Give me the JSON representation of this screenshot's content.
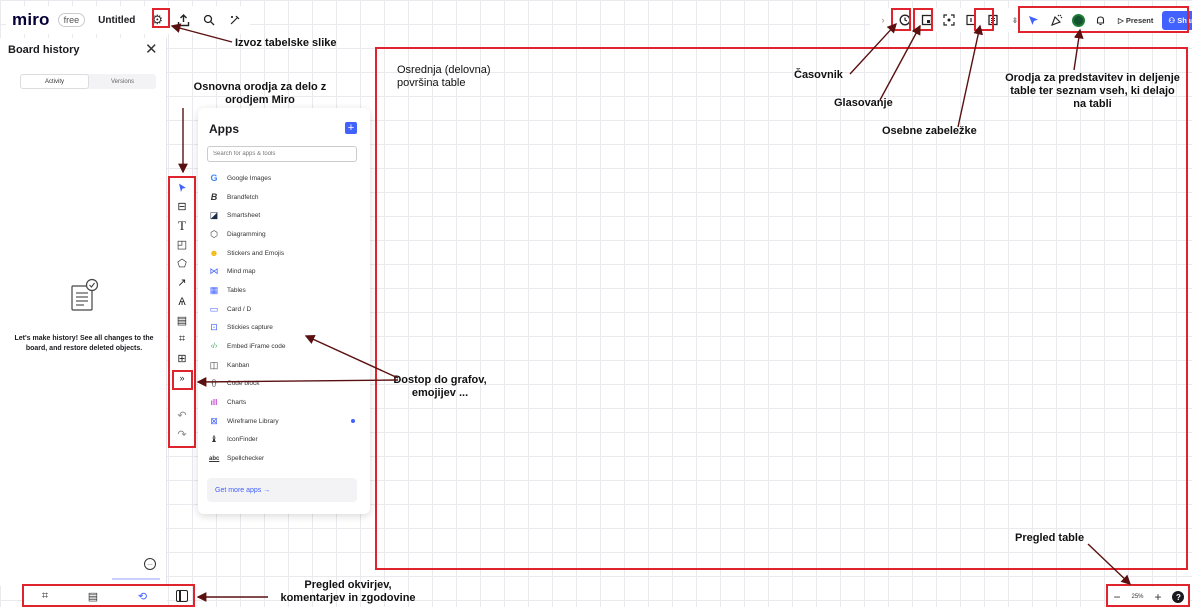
{
  "topbar": {
    "logo": "miro",
    "plan": "free",
    "board_name": "Untitled",
    "icons": [
      "gear-icon",
      "export-icon",
      "search-icon",
      "magic-icon"
    ]
  },
  "toolbar_right": {
    "present_label": "▷ Present",
    "share_label": "Share",
    "accent": "#4262ff"
  },
  "history": {
    "title": "Board history",
    "tabs": [
      "Activity",
      "Versions"
    ],
    "empty_message": "Let's make history! See all changes to the board, and restore deleted objects."
  },
  "apps": {
    "title": "Apps",
    "search_placeholder": "Search for apps & tools",
    "items": [
      {
        "label": "Google Images",
        "icon": "G"
      },
      {
        "label": "Brandfetch",
        "icon": "B"
      },
      {
        "label": "Smartsheet",
        "icon": "◪"
      },
      {
        "label": "Diagramming",
        "icon": "⬡"
      },
      {
        "label": "Stickers and Emojis",
        "icon": "☻"
      },
      {
        "label": "Mind map",
        "icon": "⋈"
      },
      {
        "label": "Tables",
        "icon": "▦"
      },
      {
        "label": "Card / D",
        "icon": "▭"
      },
      {
        "label": "Stickies capture",
        "icon": "⊡"
      },
      {
        "label": "Embed iFrame code",
        "icon": "‹/›"
      },
      {
        "label": "Kanban",
        "icon": "◫"
      },
      {
        "label": "Code block",
        "icon": "{}"
      },
      {
        "label": "Charts",
        "icon": "ıll"
      },
      {
        "label": "Wireframe Library",
        "icon": "⊠"
      },
      {
        "label": "IconFinder",
        "icon": "♝"
      },
      {
        "label": "Spellchecker",
        "icon": "abc"
      }
    ],
    "get_more_label": "Get more apps →"
  },
  "zoom": {
    "value": "25%"
  },
  "annotations": {
    "export": "Izvoz tabelske slike",
    "basic_tools": "Osnovna orodja za delo z\norodjem Miro",
    "work_surface": "Osrednja (delovna)\npovršina table",
    "timer": "Časovnik",
    "voting": "Glasovanje",
    "notes": "Osebne zabeležke",
    "sharing": "Orodja za predstavitev in deljenje\ntable ter seznam vseh, ki delajo\nna tabli",
    "access": "Dostop do grafov,\nemojijev ...",
    "overview": "Pregled table",
    "frames": "Pregled okvirjev,\nkomentarjev in zgodovine"
  }
}
